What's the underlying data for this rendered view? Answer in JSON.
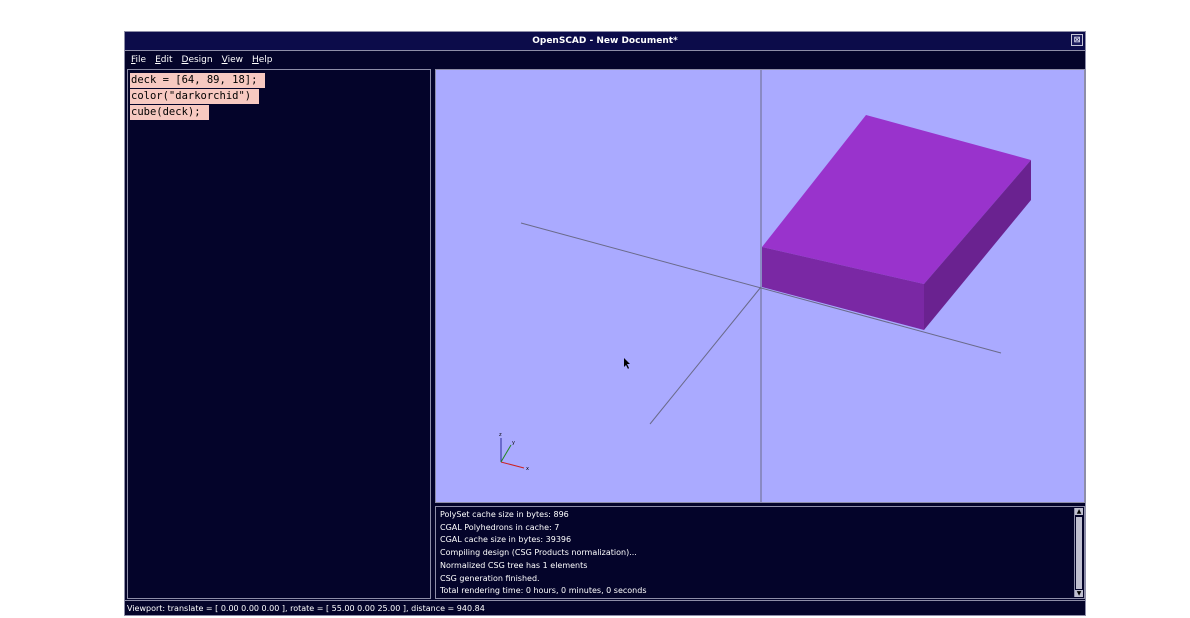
{
  "window": {
    "title": "OpenSCAD - New Document*",
    "close_glyph": "⊠"
  },
  "menu": {
    "items": [
      {
        "label": "File"
      },
      {
        "label": "Edit"
      },
      {
        "label": "Design"
      },
      {
        "label": "View"
      },
      {
        "label": "Help"
      }
    ]
  },
  "editor": {
    "lines": [
      "deck = [64, 89, 18];",
      "color(\"darkorchid\")",
      "cube(deck);"
    ]
  },
  "viewport": {
    "background_color": "#aaaaff",
    "model_color_top": "#9933cc",
    "model_color_front": "#7a28a4",
    "model_color_side": "#6a2290",
    "axes_labels": {
      "z": "z",
      "y": "y",
      "x": "x"
    }
  },
  "console": {
    "lines": [
      "PolySet cache size in bytes: 896",
      "CGAL Polyhedrons in cache: 7",
      "CGAL cache size in bytes: 39396",
      "Compiling design (CSG Products normalization)...",
      "Normalized CSG tree has 1 elements",
      "CSG generation finished.",
      "Total rendering time: 0 hours, 0 minutes, 0 seconds"
    ],
    "scroll_up": "▲",
    "scroll_down": "▼"
  },
  "status": {
    "text": "Viewport: translate = [ 0.00 0.00 0.00 ], rotate = [ 55.00 0.00 25.00 ], distance = 940.84"
  }
}
